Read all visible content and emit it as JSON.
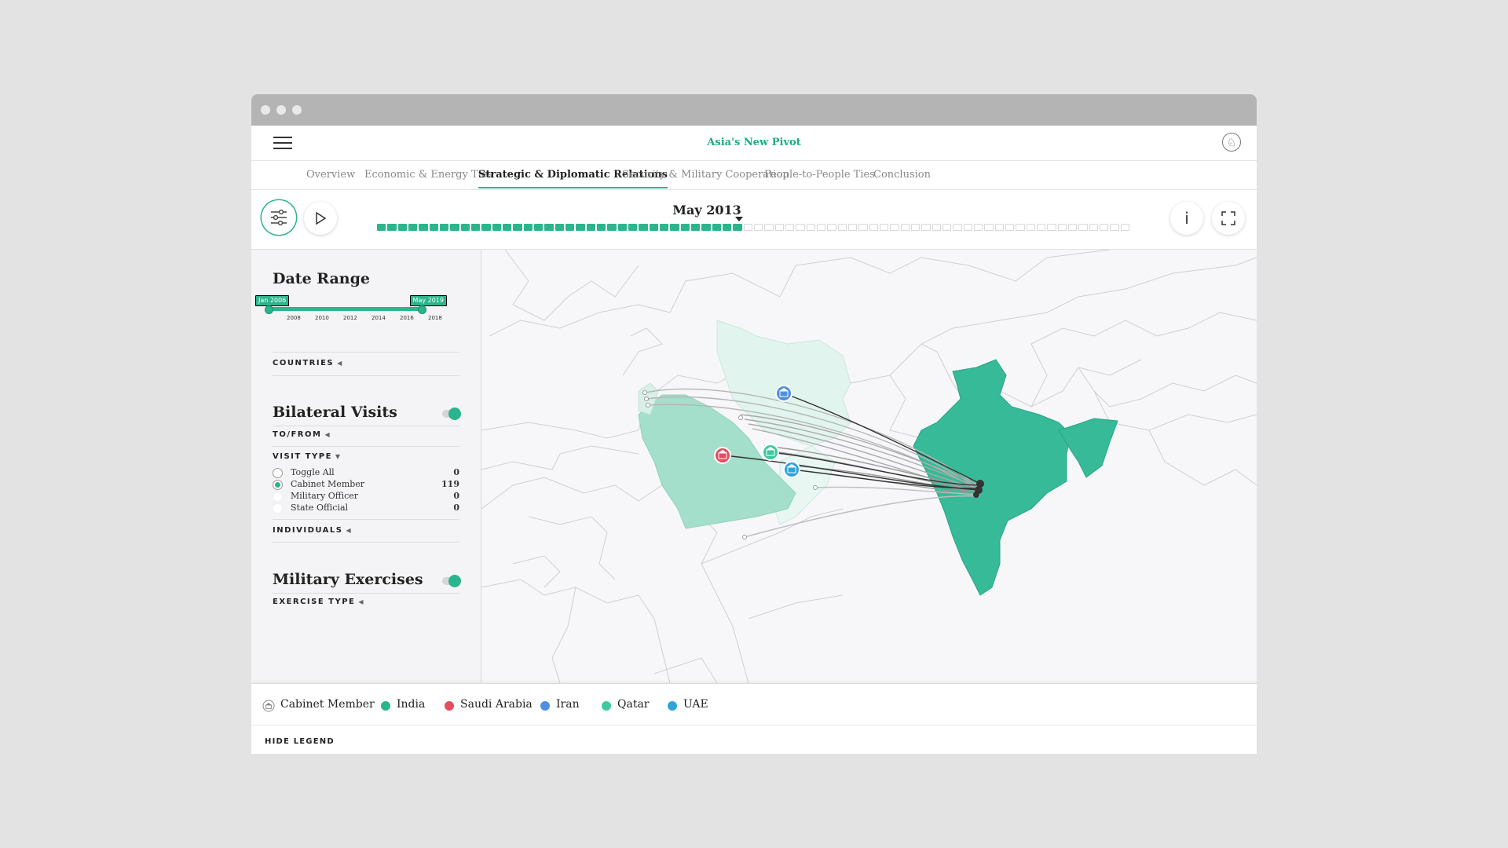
{
  "app": {
    "title": "Asia's New Pivot"
  },
  "nav": {
    "tabs": [
      {
        "label": "Overview"
      },
      {
        "label": "Economic & Energy Ties"
      },
      {
        "label": "Strategic & Diplomatic Relations"
      },
      {
        "label": "Security & Military Cooperation"
      },
      {
        "label": "People-to-People Ties"
      },
      {
        "label": "Conclusion"
      }
    ],
    "active_tab": "Strategic & Diplomatic Relations"
  },
  "timeline": {
    "current_date": "May 2013",
    "progress_fraction": 0.48,
    "segment_count": 72
  },
  "sidebar": {
    "date_range": {
      "title": "Date Range",
      "start_label": "Jan 2006",
      "end_label": "May 2019",
      "ticks": [
        "2008",
        "2010",
        "2012",
        "2014",
        "2016",
        "2018"
      ]
    },
    "countries_label": "COUNTRIES",
    "bilateral_visits": {
      "title": "Bilateral Visits",
      "enabled": true,
      "to_from_label": "TO/FROM",
      "visit_type_label": "VISIT TYPE",
      "options": [
        {
          "label": "Toggle All",
          "count": "0",
          "selected": false
        },
        {
          "label": "Cabinet Member",
          "count": "119",
          "selected": true
        },
        {
          "label": "Military Officer",
          "count": "0",
          "selected": false
        },
        {
          "label": "State Official",
          "count": "0",
          "selected": false
        }
      ],
      "individuals_label": "INDIVIDUALS"
    },
    "military_exercises": {
      "title": "Military Exercises",
      "enabled": true,
      "exercise_type_label": "EXERCISE TYPE"
    }
  },
  "legend": {
    "items": [
      {
        "label": "Cabinet Member",
        "icon": "cabinet-member-icon"
      },
      {
        "label": "India",
        "color": "#2bb58d"
      },
      {
        "label": "Saudi Arabia",
        "color": "#e44d5e"
      },
      {
        "label": "Iran",
        "color": "#4f8fe0"
      },
      {
        "label": "Qatar",
        "color": "#3ec9a0"
      },
      {
        "label": "UAE",
        "color": "#2fa3db"
      }
    ],
    "hide_label": "HIDE LEGEND"
  },
  "colors": {
    "accent": "#2bb58d",
    "india_fill": "#37ba97",
    "saudi_fill": "#a3dfcb",
    "iran_fill": "#e1f4ed"
  }
}
